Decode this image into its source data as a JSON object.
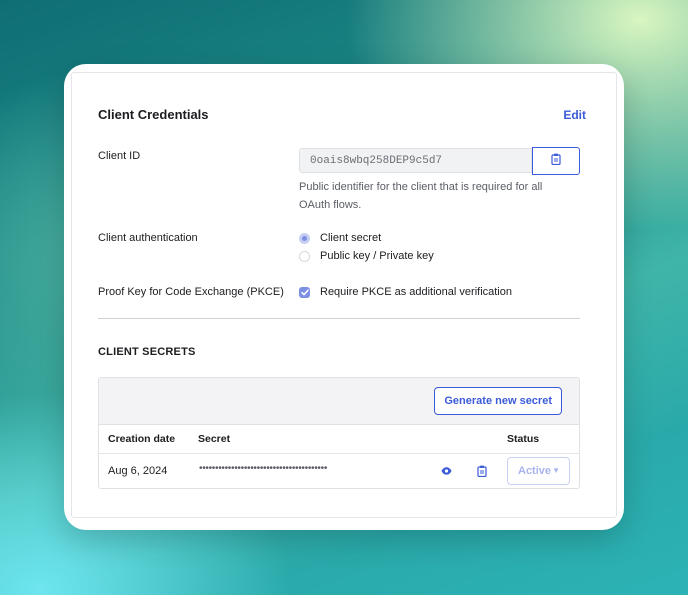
{
  "panel": {
    "title": "Client Credentials",
    "edit_label": "Edit"
  },
  "client_id": {
    "label": "Client ID",
    "value": "0oais8wbq258DEP9c5d7",
    "help": "Public identifier for the client that is required for all OAuth flows.",
    "copy_icon": "clipboard-icon"
  },
  "client_auth": {
    "label": "Client authentication",
    "options": [
      {
        "label": "Client secret",
        "selected": true
      },
      {
        "label": "Public key / Private key",
        "selected": false
      }
    ]
  },
  "pkce": {
    "label": "Proof Key for Code Exchange (PKCE)",
    "checkbox_label": "Require PKCE as additional verification",
    "checked": true
  },
  "secrets": {
    "heading": "CLIENT SECRETS",
    "generate_label": "Generate new secret",
    "columns": [
      "Creation date",
      "Secret",
      "Status"
    ],
    "rows": [
      {
        "creation_date": "Aug 6, 2024",
        "secret_masked": "••••••••••••••••••••••••••••••••••••••••",
        "status": "Active",
        "reveal_icon": "eye-icon",
        "copy_icon": "clipboard-icon"
      }
    ]
  },
  "colors": {
    "accent": "#3b5bd9",
    "accent_soft": "#7d8fe3"
  }
}
